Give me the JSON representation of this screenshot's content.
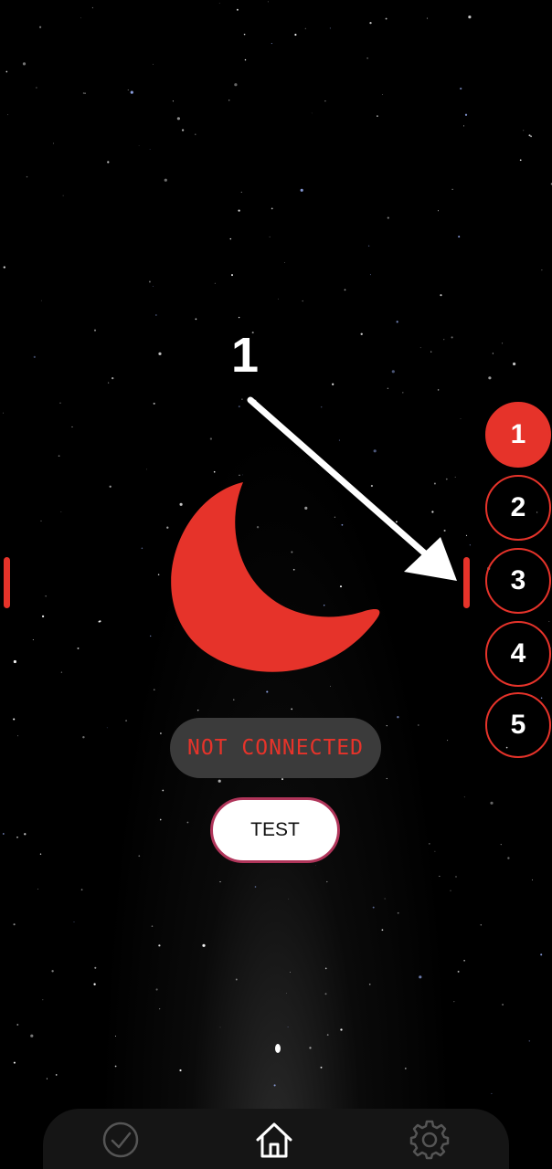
{
  "annotation": {
    "number": "1"
  },
  "status": {
    "text": "NOT CONNECTED"
  },
  "test_button": {
    "label": "TEST"
  },
  "steps": {
    "items": [
      "1",
      "2",
      "3",
      "4",
      "5"
    ],
    "active_index": 0
  },
  "bottom_nav": {
    "icons": [
      "check-circle-icon",
      "home-icon",
      "settings-gear-icon"
    ],
    "selected": "home-icon"
  },
  "colors": {
    "accent": "#e6332a",
    "pill_bg": "#3b3b3b",
    "button_border": "#b0355a",
    "nav_bg": "#151515"
  }
}
